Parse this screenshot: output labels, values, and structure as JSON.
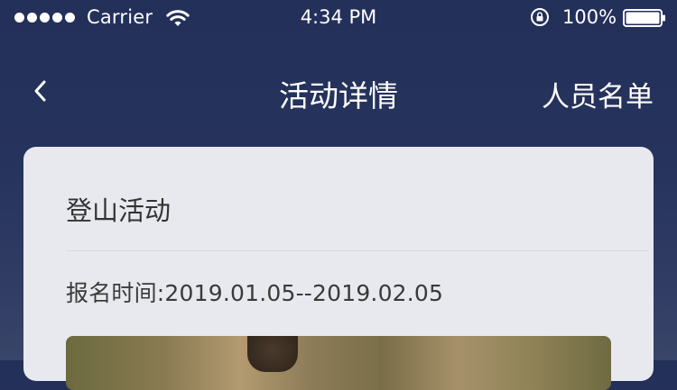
{
  "status_bar": {
    "carrier": "Carrier",
    "time": "4:34 PM",
    "battery": "100%",
    "signal_icon": "signal-dots-icon",
    "wifi_icon": "wifi-icon",
    "lock_icon": "rotation-lock-icon",
    "battery_icon": "battery-icon"
  },
  "nav": {
    "back_icon": "chevron-left-icon",
    "title": "活动详情",
    "right_label": "人员名单"
  },
  "activity": {
    "title": "登山活动",
    "registration_time": "报名时间:2019.01.05--2019.02.05"
  },
  "colors": {
    "nav_background": "#23305a",
    "card_background": "#e8e9ee",
    "text_dark": "#333333"
  }
}
